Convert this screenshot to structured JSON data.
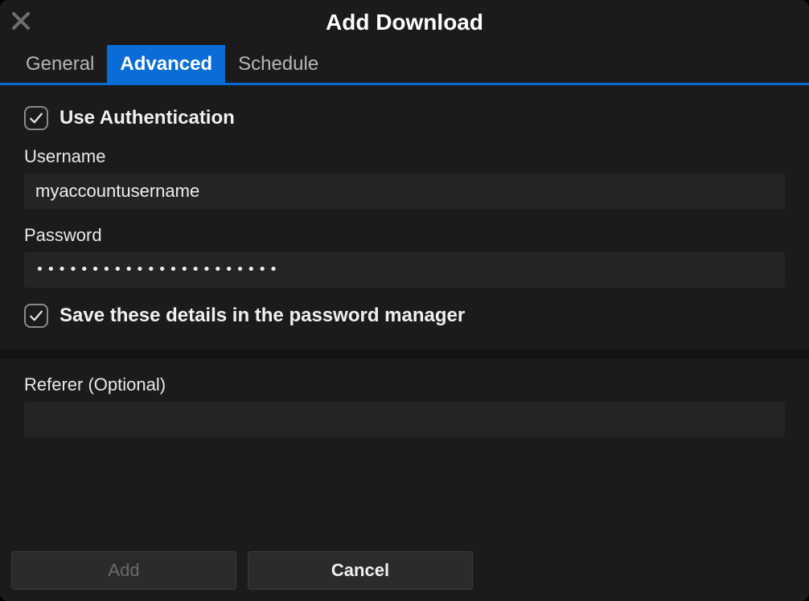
{
  "dialog": {
    "title": "Add Download"
  },
  "tabs": {
    "general": "General",
    "advanced": "Advanced",
    "schedule": "Schedule",
    "active": "advanced"
  },
  "auth": {
    "use_auth_label": "Use Authentication",
    "use_auth_checked": true,
    "username_label": "Username",
    "username_value": "myaccountusername",
    "password_label": "Password",
    "password_value": "••••••••••••••••••••••",
    "save_pw_label": "Save these details in the password manager",
    "save_pw_checked": true
  },
  "referer": {
    "label": "Referer (Optional)",
    "value": ""
  },
  "buttons": {
    "add": "Add",
    "cancel": "Cancel"
  }
}
